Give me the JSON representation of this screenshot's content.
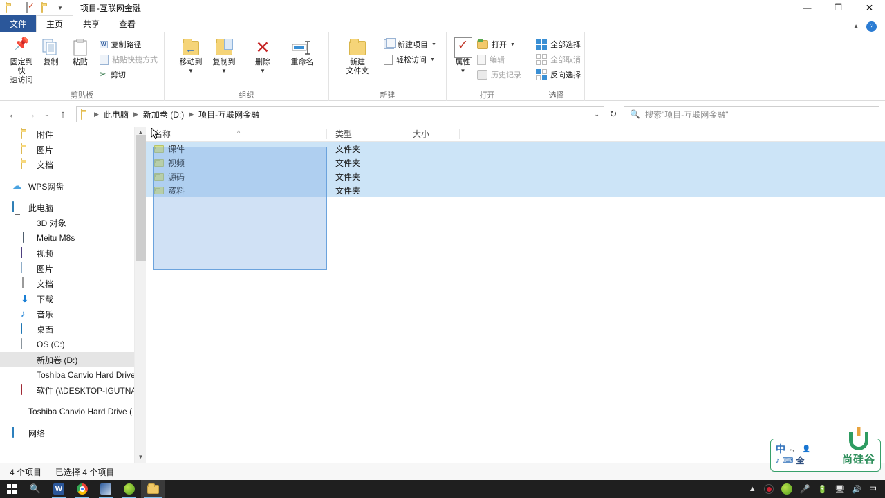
{
  "window": {
    "title": "项目-互联网金融",
    "quick_access": [
      "folder-icon",
      "properties-icon",
      "new-folder-icon"
    ],
    "controls": {
      "minimize": "—",
      "maximize": "❐",
      "close": "✕"
    }
  },
  "tabs": [
    {
      "label": "文件",
      "kind": "file"
    },
    {
      "label": "主页",
      "kind": "active"
    },
    {
      "label": "共享",
      "kind": "normal"
    },
    {
      "label": "查看",
      "kind": "normal"
    }
  ],
  "ribbon": {
    "groups": [
      {
        "label": "剪贴板",
        "big": [
          {
            "label": "固定到快\n速访问",
            "icon": "pin-icon"
          },
          {
            "label": "复制",
            "icon": "copy-icon"
          },
          {
            "label": "粘贴",
            "icon": "paste-icon"
          }
        ],
        "small": [
          {
            "label": "复制路径",
            "icon": "copy-path-icon"
          },
          {
            "label": "粘贴快捷方式",
            "icon": "paste-shortcut-icon",
            "dim": true
          },
          {
            "label": "剪切",
            "icon": "scissors-icon"
          }
        ]
      },
      {
        "label": "组织",
        "big": [
          {
            "label": "移动到",
            "icon": "move-to-icon",
            "caret": true
          },
          {
            "label": "复制到",
            "icon": "copy-to-icon",
            "caret": true
          },
          {
            "label": "删除",
            "icon": "delete-icon",
            "caret": true
          },
          {
            "label": "重命名",
            "icon": "rename-icon"
          }
        ]
      },
      {
        "label": "新建",
        "big": [
          {
            "label": "新建\n文件夹",
            "icon": "new-folder-icon"
          }
        ],
        "small": [
          {
            "label": "新建项目",
            "icon": "new-item-icon",
            "caret": true
          },
          {
            "label": "轻松访问",
            "icon": "easy-access-icon",
            "caret": true
          }
        ]
      },
      {
        "label": "打开",
        "big": [
          {
            "label": "属性",
            "icon": "properties-icon",
            "caret": true
          }
        ],
        "small": [
          {
            "label": "打开",
            "icon": "open-icon",
            "caret": true
          },
          {
            "label": "编辑",
            "icon": "edit-icon",
            "dim": true
          },
          {
            "label": "历史记录",
            "icon": "history-icon",
            "dim": true
          }
        ]
      },
      {
        "label": "选择",
        "small": [
          {
            "label": "全部选择",
            "icon": "select-all-icon"
          },
          {
            "label": "全部取消",
            "icon": "select-none-icon",
            "dim": true
          },
          {
            "label": "反向选择",
            "icon": "invert-selection-icon"
          }
        ]
      }
    ]
  },
  "address": {
    "back": "←",
    "forward": "→",
    "recent": "⌄",
    "up": "↑",
    "crumbs": [
      "此电脑",
      "新加卷 (D:)",
      "项目-互联网金融"
    ],
    "dropdown_caret": "⌄",
    "refresh": "↻"
  },
  "search": {
    "placeholder": "搜索\"项目-互联网金融\"",
    "icon": "search-icon"
  },
  "nav_pane": {
    "items": [
      {
        "label": "附件",
        "icon": "folder-icon",
        "indent": 30
      },
      {
        "label": "图片",
        "icon": "folder-icon",
        "indent": 30
      },
      {
        "label": "文档",
        "icon": "folder-icon",
        "indent": 30
      },
      {
        "label": "",
        "icon": "spacer",
        "indent": 0
      },
      {
        "label": "WPS网盘",
        "icon": "cloud-icon",
        "indent": 18
      },
      {
        "label": "",
        "icon": "spacer",
        "indent": 0
      },
      {
        "label": "此电脑",
        "icon": "this-pc-icon",
        "indent": 18
      },
      {
        "label": "3D 对象",
        "icon": "3d-objects-icon",
        "indent": 30
      },
      {
        "label": "Meitu M8s",
        "icon": "phone-icon",
        "indent": 30
      },
      {
        "label": "视频",
        "icon": "videos-icon",
        "indent": 30
      },
      {
        "label": "图片",
        "icon": "pictures-icon",
        "indent": 30
      },
      {
        "label": "文档",
        "icon": "documents-icon",
        "indent": 30
      },
      {
        "label": "下载",
        "icon": "downloads-icon",
        "indent": 30
      },
      {
        "label": "音乐",
        "icon": "music-icon",
        "indent": 30
      },
      {
        "label": "桌面",
        "icon": "desktop-icon",
        "indent": 30
      },
      {
        "label": "OS (C:)",
        "icon": "drive-icon",
        "indent": 30
      },
      {
        "label": "新加卷 (D:)",
        "icon": "volume-icon",
        "indent": 30,
        "selected": true
      },
      {
        "label": "Toshiba Canvio Hard Drive",
        "icon": "hdd-icon",
        "indent": 30
      },
      {
        "label": "软件 (\\\\DESKTOP-IGUTNAF",
        "icon": "network-drive-icon",
        "indent": 30
      },
      {
        "label": "",
        "icon": "spacer",
        "indent": 0
      },
      {
        "label": "Toshiba Canvio Hard Drive (",
        "icon": "hdd-icon",
        "indent": 18
      },
      {
        "label": "",
        "icon": "spacer",
        "indent": 0
      },
      {
        "label": "网络",
        "icon": "network-icon",
        "indent": 18
      }
    ]
  },
  "file_list": {
    "columns": [
      "名称",
      "类型",
      "大小"
    ],
    "sort_indicator": "^",
    "rows": [
      {
        "name": "课件",
        "type": "文件夹",
        "size": "",
        "selected": true
      },
      {
        "name": "视频",
        "type": "文件夹",
        "size": "",
        "selected": true
      },
      {
        "name": "源码",
        "type": "文件夹",
        "size": "",
        "selected": true
      },
      {
        "name": "资料",
        "type": "文件夹",
        "size": "",
        "selected": true
      }
    ]
  },
  "status_bar": {
    "count": "4 个项目",
    "selection": "已选择 4 个项目"
  },
  "ime": {
    "mode": "中",
    "punct": "◦，",
    "user": "user-icon",
    "moon": "♪",
    "keyboard": "keyboard-icon",
    "width": "全",
    "brand": "尚硅谷"
  },
  "taskbar": {
    "start": "start-icon",
    "search": "search-icon",
    "apps": [
      "wps-writer-icon",
      "chrome-icon",
      "photoshop-icon",
      "browser-icon",
      "file-explorer-icon"
    ],
    "tray": [
      "show-hidden-icon",
      "sogou-icon",
      "browser-icon",
      "mic-icon",
      "battery-icon",
      "network-icon",
      "volume-icon"
    ],
    "language": "中"
  },
  "colors": {
    "accent": "#2b579a",
    "selection": "#cce4f7",
    "marquee_border": "#6ba3dd",
    "folder": "#f2da8a"
  }
}
